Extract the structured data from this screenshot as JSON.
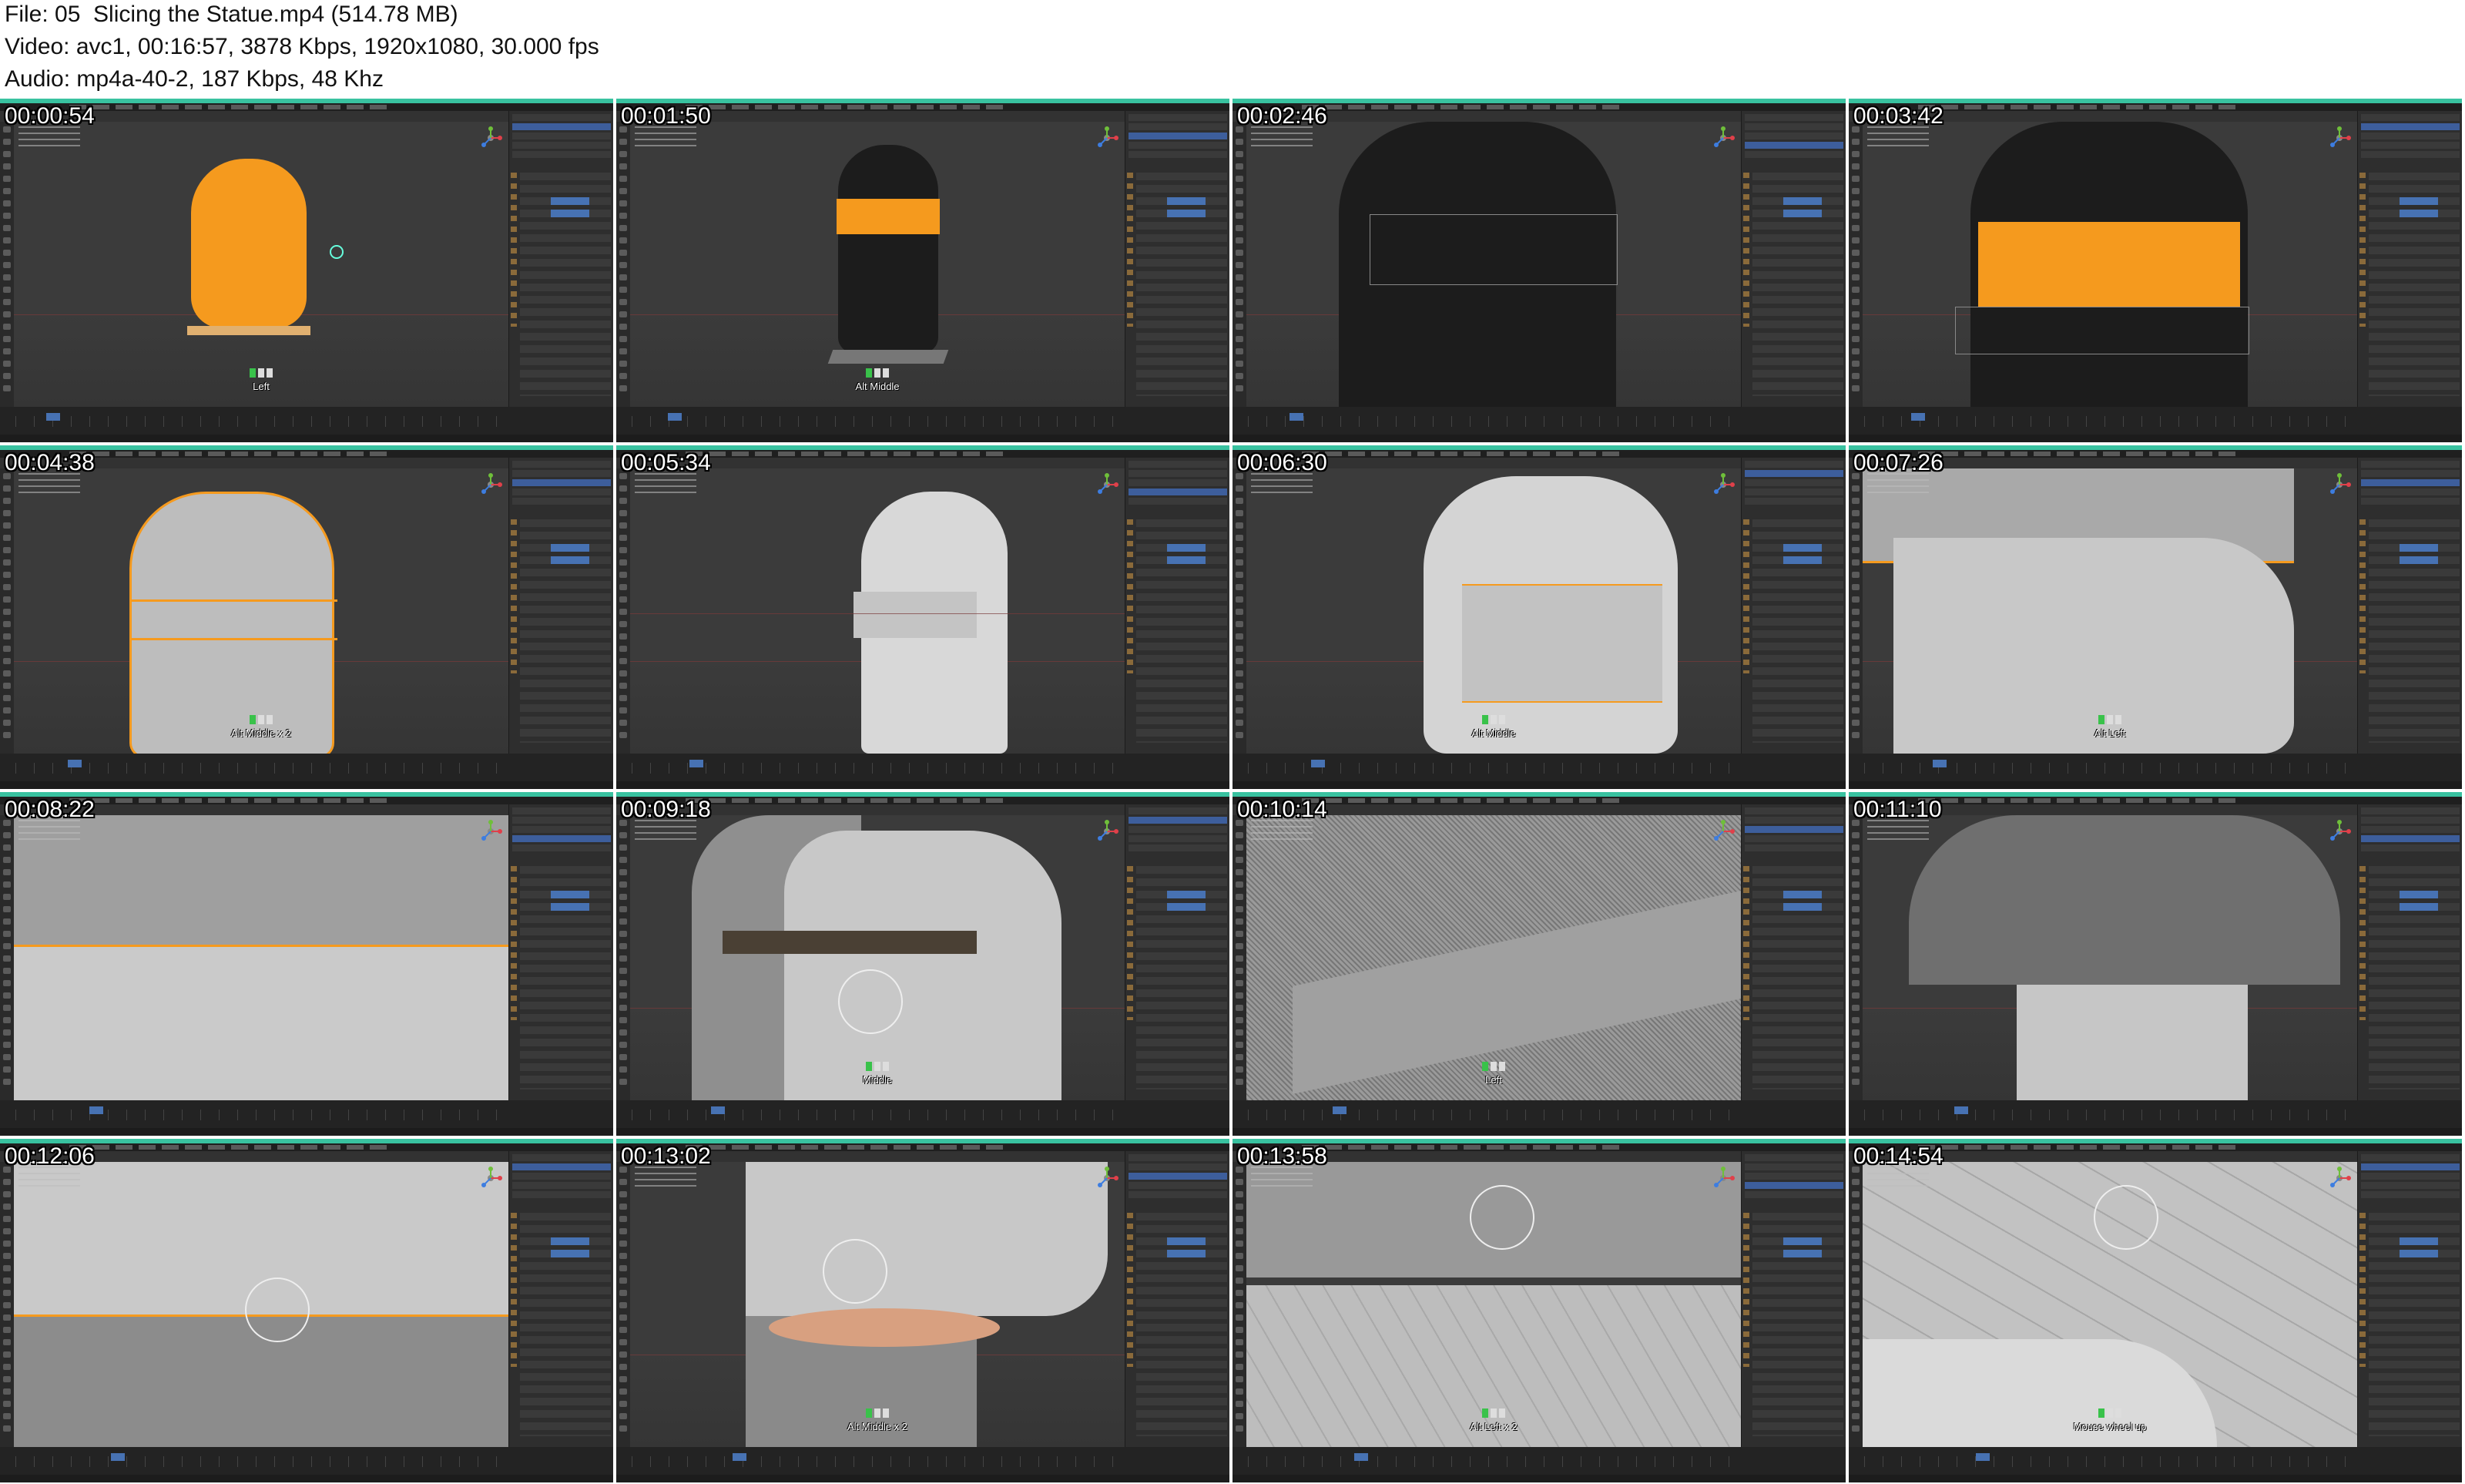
{
  "header": {
    "file_line": "File: 05  Slicing the Statue.mp4 (514.78 MB)",
    "video_line": "Video: avc1, 00:16:57, 3878 Kbps, 1920x1080, 30.000 fps",
    "audio_line": "Audio: mp4a-40-2, 187 Kbps, 48 Khz"
  },
  "colors": {
    "accent_bar": "#39c2a0",
    "selection_orange": "#f59a1e",
    "blender_blue": "#4772b3",
    "viewport_bg": "#3b3b3b"
  },
  "frames": [
    {
      "timestamp": "00:00:54",
      "key_label": "Left",
      "scene": "orange-bust"
    },
    {
      "timestamp": "00:01:50",
      "key_label": "Alt Middle",
      "scene": "dark-bust-band"
    },
    {
      "timestamp": "00:02:46",
      "key_label": "",
      "scene": "dark-face-closeup"
    },
    {
      "timestamp": "00:03:42",
      "key_label": "",
      "scene": "dark-face-orange-band"
    },
    {
      "timestamp": "00:04:38",
      "key_label": "Alt Middle x 2",
      "scene": "wire-bust"
    },
    {
      "timestamp": "00:05:34",
      "key_label": "",
      "scene": "white-profile"
    },
    {
      "timestamp": "00:06:30",
      "key_label": "Alt Middle",
      "scene": "white-face-slice"
    },
    {
      "timestamp": "00:07:26",
      "key_label": "Alt Left",
      "scene": "nose-closeup"
    },
    {
      "timestamp": "00:08:22",
      "key_label": "",
      "scene": "mesh-face-slice"
    },
    {
      "timestamp": "00:09:18",
      "key_label": "Middle",
      "scene": "hair-face-slice"
    },
    {
      "timestamp": "00:10:14",
      "key_label": "Left",
      "scene": "dense-mesh"
    },
    {
      "timestamp": "00:11:10",
      "key_label": "",
      "scene": "mesh-eyes-slice"
    },
    {
      "timestamp": "00:12:06",
      "key_label": "",
      "scene": "chin-slice"
    },
    {
      "timestamp": "00:13:02",
      "key_label": "Alt Middle x 2",
      "scene": "neck-ring"
    },
    {
      "timestamp": "00:13:58",
      "key_label": "Alt Left x 2",
      "scene": "low-poly-slice"
    },
    {
      "timestamp": "00:14:54",
      "key_label": "Mouse wheel up",
      "scene": "low-poly-closeup"
    }
  ]
}
